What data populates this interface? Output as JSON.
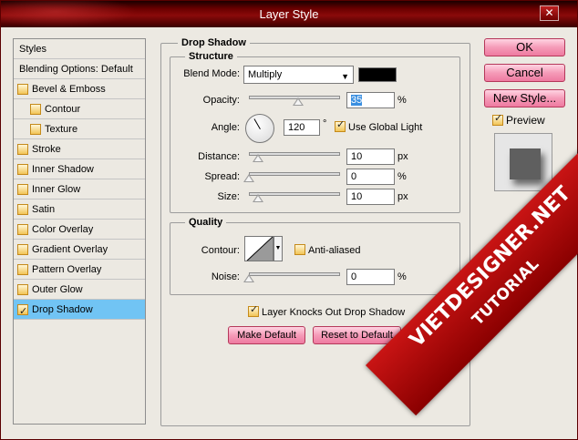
{
  "window": {
    "title": "Layer Style",
    "close_glyph": "✕"
  },
  "styles": {
    "header": "Styles",
    "blending": "Blending Options: Default",
    "items": [
      {
        "label": "Bevel & Emboss",
        "checked": false
      },
      {
        "label": "Contour",
        "checked": false,
        "indent": true
      },
      {
        "label": "Texture",
        "checked": false,
        "indent": true
      },
      {
        "label": "Stroke",
        "checked": false
      },
      {
        "label": "Inner Shadow",
        "checked": false
      },
      {
        "label": "Inner Glow",
        "checked": false
      },
      {
        "label": "Satin",
        "checked": false
      },
      {
        "label": "Color Overlay",
        "checked": false
      },
      {
        "label": "Gradient Overlay",
        "checked": false
      },
      {
        "label": "Pattern Overlay",
        "checked": false
      },
      {
        "label": "Outer Glow",
        "checked": false
      },
      {
        "label": "Drop Shadow",
        "checked": true,
        "selected": true
      }
    ]
  },
  "drop_shadow": {
    "title": "Drop Shadow",
    "structure": {
      "title": "Structure",
      "blend_mode_label": "Blend Mode:",
      "blend_mode_value": "Multiply",
      "shadow_color": "#000000",
      "opacity_label": "Opacity:",
      "opacity_value": "35",
      "opacity_unit": "%",
      "angle_label": "Angle:",
      "angle_value": "120",
      "angle_unit": "°",
      "global_light_label": "Use Global Light",
      "global_light_checked": true,
      "distance_label": "Distance:",
      "distance_value": "10",
      "distance_unit": "px",
      "spread_label": "Spread:",
      "spread_value": "0",
      "spread_unit": "%",
      "size_label": "Size:",
      "size_value": "10",
      "size_unit": "px"
    },
    "quality": {
      "title": "Quality",
      "contour_label": "Contour:",
      "anti_aliased_label": "Anti-aliased",
      "anti_aliased_checked": false,
      "noise_label": "Noise:",
      "noise_value": "0",
      "noise_unit": "%"
    },
    "knockout_label": "Layer Knocks Out Drop Shadow",
    "knockout_checked": true,
    "make_default": "Make Default",
    "reset_default": "Reset to Default"
  },
  "actions": {
    "ok": "OK",
    "cancel": "Cancel",
    "new_style": "New Style...",
    "preview_label": "Preview",
    "preview_checked": true
  },
  "watermark": {
    "line1": "VIETDESIGNER.NET",
    "line2": "TUTORIAL"
  },
  "colors": {
    "accent_pink": "#f59bb8",
    "selection": "#71c4f4",
    "checkbox": "#f2c456",
    "title_bar": "#6a0000"
  }
}
